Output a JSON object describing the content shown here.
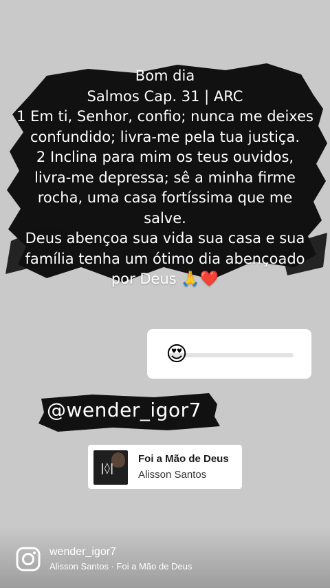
{
  "story": {
    "lines": [
      "Bom dia",
      "Salmos Cap. 31 | ARC",
      "1 Em ti, Senhor, confio; nunca me deixes",
      "confundido; livra-me pela tua justiça.",
      "2 Inclina para mim os teus ouvidos,",
      "livra-me depressa; sê a minha firme",
      "rocha, uma casa fortíssima que me",
      "salve.",
      "Deus abençoa sua vida sua casa e sua",
      "família tenha um ótimo dia abençoado",
      "por Deus"
    ],
    "emojis": [
      "🙏",
      "❤️"
    ]
  },
  "slider": {
    "emoji": "😍",
    "value_fraction": 0.0
  },
  "mention": {
    "handle": "@wender_igor7"
  },
  "music": {
    "title": "Foi a Mão de Deus",
    "artist": "Alisson Santos",
    "album_art_icon": "album-cover"
  },
  "footer": {
    "icon": "instagram-icon",
    "username": "wender_igor7",
    "song_info": "Alisson Santos · Foi a Mão de Deus"
  },
  "colors": {
    "background": "#c9c9c9",
    "brush": "#111111",
    "text": "#ffffff"
  }
}
